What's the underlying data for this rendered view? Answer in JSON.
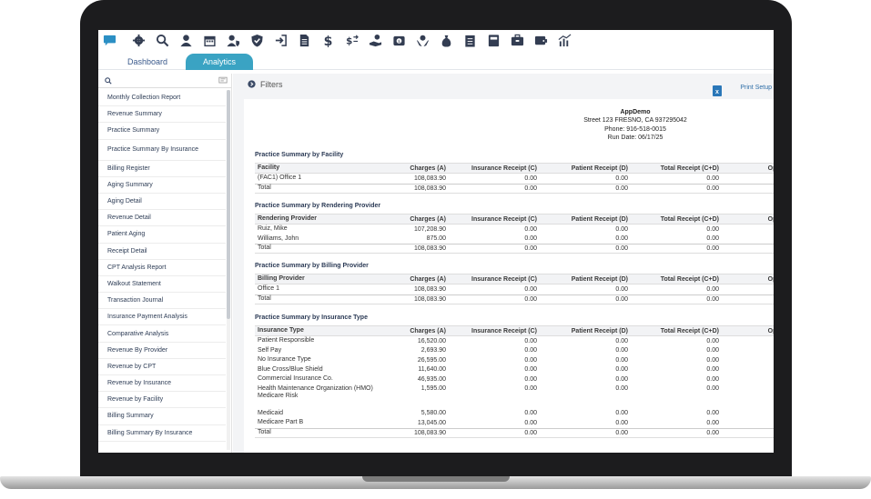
{
  "toolbar": {
    "icons": [
      "chat-icon",
      "gear-icon",
      "search-icon",
      "user-icon",
      "calendar-icon",
      "user-shield-icon",
      "shield-check-icon",
      "sign-in-icon",
      "document-icon",
      "dollar-icon",
      "dollar-arrows-icon",
      "hand-money-icon",
      "money-box-icon",
      "hands-dollar-icon",
      "money-bag-icon",
      "clipboard-list-icon",
      "book-icon",
      "briefcase-icon",
      "wallet-icon",
      "bar-chart-icon"
    ],
    "accent": "#2b8fc4"
  },
  "tabs": {
    "dashboard": "Dashboard",
    "analytics": "Analytics",
    "active_color": "#3aa3c3"
  },
  "sidebar": {
    "search_placeholder": "",
    "items": [
      "Monthly Collection Report",
      "Revenue Summary",
      "Practice Summary",
      "Practice Summary By Insurance",
      "Billing Register",
      "Aging Summary",
      "Aging Detail",
      "Revenue Detail",
      "Patient Aging",
      "Receipt Detail",
      "CPT Analysis Report",
      "Walkout Statement",
      "Transaction Journal",
      "Insurance Payment Analysis",
      "Comparative Analysis",
      "Revenue By Provider",
      "Revenue by CPT",
      "Revenue by Insurance",
      "Revenue by Facility",
      "Billing Summary",
      "Billing Summary By Insurance"
    ]
  },
  "filters": {
    "label": "Filters",
    "print_setup": "Print Setup"
  },
  "report": {
    "org": "AppDemo",
    "address": "Street 123 FRESNO, CA 937295042",
    "phone": "Phone: 916-518-0015",
    "run_date": "Run Date: 06/17/25",
    "sections": [
      {
        "title": "Practice Summary by Facility",
        "columns": [
          "Facility",
          "Charges (A)",
          "Insurance Receipt (C)",
          "Patient Receipt (D)",
          "Total Receipt (C+D)",
          "Oper"
        ],
        "rows": [
          [
            "(FAC1) Office 1",
            "108,083.90",
            "0.00",
            "0.00",
            "0.00"
          ]
        ],
        "total": [
          "Total",
          "108,083.90",
          "0.00",
          "0.00",
          "0.00"
        ]
      },
      {
        "title": "Practice Summary by Rendering Provider",
        "columns": [
          "Rendering Provider",
          "Charges (A)",
          "Insurance Receipt (C)",
          "Patient Receipt (D)",
          "Total Receipt (C+D)",
          "Oper"
        ],
        "rows": [
          [
            "Ruiz, Mike",
            "107,208.90",
            "0.00",
            "0.00",
            "0.00"
          ],
          [
            "Williams, John",
            "875.00",
            "0.00",
            "0.00",
            "0.00"
          ]
        ],
        "total": [
          "Total",
          "108,083.90",
          "0.00",
          "0.00",
          "0.00"
        ]
      },
      {
        "title": "Practice Summary by Billing Provider",
        "columns": [
          "Billing Provider",
          "Charges (A)",
          "Insurance Receipt (C)",
          "Patient Receipt (D)",
          "Total Receipt (C+D)",
          "Oper"
        ],
        "rows": [
          [
            "Office 1",
            "108,083.90",
            "0.00",
            "0.00",
            "0.00"
          ]
        ],
        "total": [
          "Total",
          "108,083.90",
          "0.00",
          "0.00",
          "0.00"
        ]
      },
      {
        "title": "Practice Summary by Insurance Type",
        "columns": [
          "Insurance Type",
          "Charges (A)",
          "Insurance Receipt (C)",
          "Patient Receipt (D)",
          "Total Receipt (C+D)",
          "Oper"
        ],
        "rows": [
          [
            "Patient Responsible",
            "16,520.00",
            "0.00",
            "0.00",
            "0.00"
          ],
          [
            "Self Pay",
            "2,693.90",
            "0.00",
            "0.00",
            "0.00"
          ],
          [
            "No Insurance Type",
            "26,595.00",
            "0.00",
            "0.00",
            "0.00"
          ],
          [
            "Blue Cross/Blue Shield",
            "11,640.00",
            "0.00",
            "0.00",
            "0.00"
          ],
          [
            "Commercial Insurance Co.",
            "46,935.00",
            "0.00",
            "0.00",
            "0.00"
          ],
          [
            "Health Maintenance Organization (HMO) Medicare Risk",
            "1,595.00",
            "0.00",
            "0.00",
            "0.00"
          ],
          [
            "Medicaid",
            "5,580.00",
            "0.00",
            "0.00",
            "0.00"
          ],
          [
            "Medicare Part B",
            "13,045.00",
            "0.00",
            "0.00",
            "0.00"
          ]
        ],
        "total": [
          "Total",
          "108,083.90",
          "0.00",
          "0.00",
          "0.00"
        ]
      }
    ]
  }
}
